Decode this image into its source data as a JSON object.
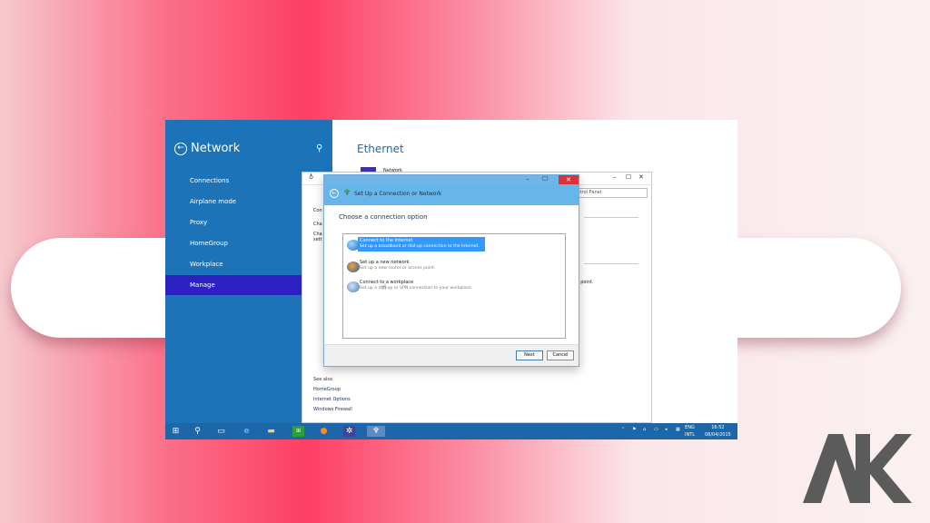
{
  "settings": {
    "title": "Network",
    "back_label": "←",
    "search_glyph": "⚲",
    "items": [
      {
        "label": "Connections"
      },
      {
        "label": "Airplane mode"
      },
      {
        "label": "Proxy"
      },
      {
        "label": "HomeGroup"
      },
      {
        "label": "Workplace"
      },
      {
        "label": "Manage"
      }
    ],
    "selected": "Manage"
  },
  "ethernet": {
    "title": "Ethernet",
    "tile_label": "Network"
  },
  "control_panel": {
    "search_placeholder": "Control Panel",
    "left_snippets": [
      "Con",
      "Cha",
      "Cha",
      "sett"
    ],
    "right_snippets": [
      "s point."
    ],
    "see_also_label": "See also",
    "links": [
      "HomeGroup",
      "Internet Options",
      "Windows Firewall"
    ]
  },
  "wizard": {
    "title": "Set Up a Connection or Network",
    "heading": "Choose a connection option",
    "options": [
      {
        "title": "Connect to the Internet",
        "description": "Set up a broadband or dial-up connection to the Internet.",
        "selected": true,
        "icon": "globe-icon"
      },
      {
        "title": "Set up a new network",
        "description": "Set up a new router or access point.",
        "selected": false,
        "icon": "router-icon"
      },
      {
        "title": "Connect to a workplace",
        "description": "Set up a dial-up or VPN connection to your workplace.",
        "selected": false,
        "icon": "workplace-icon"
      }
    ],
    "next_label": "Next",
    "cancel_label": "Cancel"
  },
  "taskbar": {
    "icons": [
      "windows-icon",
      "search-icon",
      "task-view-icon",
      "ie-icon",
      "file-explorer-icon",
      "store-icon",
      "firefox-icon",
      "settings-icon",
      "network-wizard-icon"
    ],
    "language": "ENG",
    "layout": "INTL",
    "time": "16:52",
    "date": "08/04/2015"
  },
  "colors": {
    "settings_blue": "#1d73b8",
    "selected_nav": "#2a21c0",
    "wizard_header": "#66b6ec",
    "highlight": "#3399ff",
    "close_red": "#d9333a"
  }
}
